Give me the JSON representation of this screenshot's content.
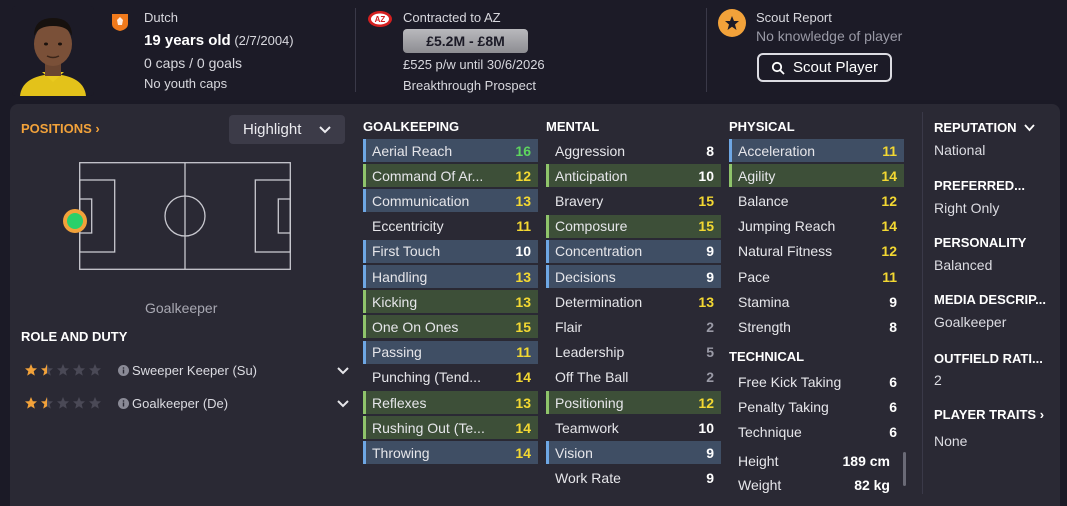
{
  "player": {
    "nationality": "Dutch",
    "age": "19 years old",
    "dob": "(2/7/2004)",
    "caps_goals": "0 caps / 0 goals",
    "youth_caps": "No youth caps",
    "contract": "Contracted to AZ",
    "value_range": "£5.2M - £8M",
    "wage": "£525 p/w until 30/6/2026",
    "status": "Breakthrough Prospect"
  },
  "scout": {
    "title": "Scout Report",
    "knowledge": "No knowledge of player",
    "button": "Scout Player"
  },
  "positions": {
    "title": "POSITIONS",
    "dropdown": "Highlight",
    "position_label": "Goalkeeper"
  },
  "roles": {
    "title": "ROLE AND DUTY",
    "items": [
      {
        "name": "Sweeper Keeper (Su)",
        "stars": 1.5
      },
      {
        "name": "Goalkeeper (De)",
        "stars": 1.5
      }
    ]
  },
  "goalkeeping": {
    "title": "GOALKEEPING",
    "attrs": [
      {
        "name": "Aerial Reach",
        "value": "16"
      },
      {
        "name": "Command Of Ar...",
        "value": "12"
      },
      {
        "name": "Communication",
        "value": "13"
      },
      {
        "name": "Eccentricity",
        "value": "11"
      },
      {
        "name": "First Touch",
        "value": "10"
      },
      {
        "name": "Handling",
        "value": "13"
      },
      {
        "name": "Kicking",
        "value": "13"
      },
      {
        "name": "One On Ones",
        "value": "15"
      },
      {
        "name": "Passing",
        "value": "11"
      },
      {
        "name": "Punching (Tend...",
        "value": "14"
      },
      {
        "name": "Reflexes",
        "value": "13"
      },
      {
        "name": "Rushing Out (Te...",
        "value": "14"
      },
      {
        "name": "Throwing",
        "value": "14"
      }
    ]
  },
  "mental": {
    "title": "MENTAL",
    "attrs": [
      {
        "name": "Aggression",
        "value": "8"
      },
      {
        "name": "Anticipation",
        "value": "10"
      },
      {
        "name": "Bravery",
        "value": "15"
      },
      {
        "name": "Composure",
        "value": "15"
      },
      {
        "name": "Concentration",
        "value": "9"
      },
      {
        "name": "Decisions",
        "value": "9"
      },
      {
        "name": "Determination",
        "value": "13"
      },
      {
        "name": "Flair",
        "value": "2"
      },
      {
        "name": "Leadership",
        "value": "5"
      },
      {
        "name": "Off The Ball",
        "value": "2"
      },
      {
        "name": "Positioning",
        "value": "12"
      },
      {
        "name": "Teamwork",
        "value": "10"
      },
      {
        "name": "Vision",
        "value": "9"
      },
      {
        "name": "Work Rate",
        "value": "9"
      }
    ]
  },
  "physical": {
    "title": "PHYSICAL",
    "attrs": [
      {
        "name": "Acceleration",
        "value": "11"
      },
      {
        "name": "Agility",
        "value": "14"
      },
      {
        "name": "Balance",
        "value": "12"
      },
      {
        "name": "Jumping Reach",
        "value": "14"
      },
      {
        "name": "Natural Fitness",
        "value": "12"
      },
      {
        "name": "Pace",
        "value": "11"
      },
      {
        "name": "Stamina",
        "value": "9"
      },
      {
        "name": "Strength",
        "value": "8"
      }
    ]
  },
  "technical": {
    "title": "TECHNICAL",
    "attrs": [
      {
        "name": "Free Kick Taking",
        "value": "6"
      },
      {
        "name": "Penalty Taking",
        "value": "6"
      },
      {
        "name": "Technique",
        "value": "6"
      }
    ]
  },
  "body": {
    "height_label": "Height",
    "height": "189 cm",
    "weight_label": "Weight",
    "weight": "82 kg"
  },
  "info": {
    "reputation_title": "REPUTATION",
    "reputation": "National",
    "foot_title": "PREFERRED...",
    "foot": "Right Only",
    "personality_title": "PERSONALITY",
    "personality": "Balanced",
    "media_title": "MEDIA DESCRIP...",
    "media": "Goalkeeper",
    "outfield_title": "OUTFIELD RATI...",
    "outfield": "2",
    "traits_title": "PLAYER TRAITS",
    "traits": "None"
  },
  "colors": {
    "accent_orange": "#f2a23a",
    "highlight_blue": "#3f4e64",
    "highlight_green": "#3d4f38",
    "value_yellow": "#f3d832",
    "value_green": "#5ed65e"
  },
  "icons": [
    "netherlands-flag-icon",
    "az-club-logo-icon",
    "star-icon",
    "search-icon",
    "chevron-down-icon",
    "chevron-right-icon",
    "info-icon"
  ]
}
